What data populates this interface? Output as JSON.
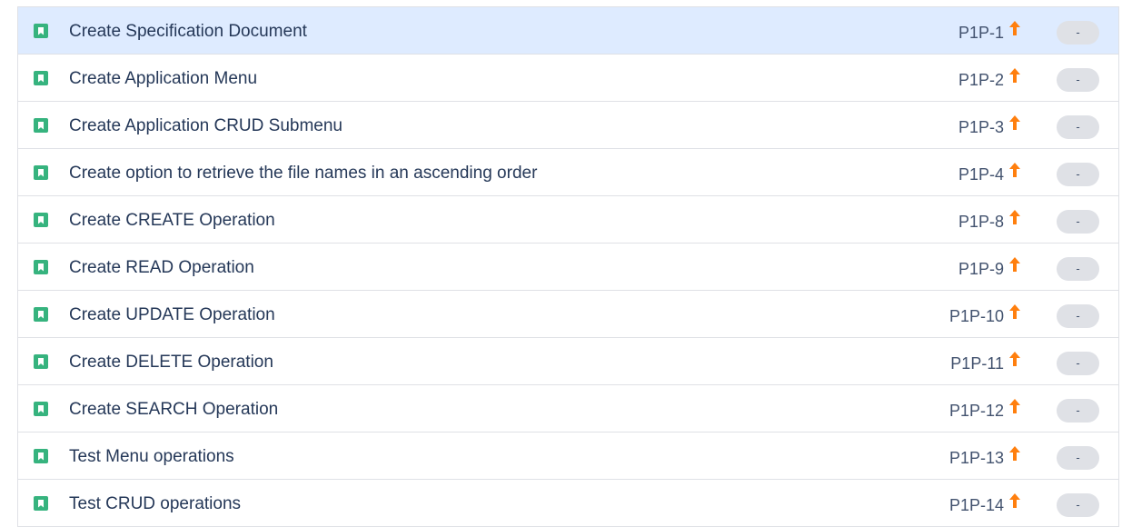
{
  "colors": {
    "story_icon": "#36b37e",
    "priority_high": "#ff7f0e",
    "selected_row": "#deebff",
    "lozenge_bg": "#dfe1e6"
  },
  "icons": {
    "type": "story-bookmark-icon",
    "priority": "arrow-up-icon"
  },
  "issues": [
    {
      "summary": "Create Specification Document",
      "key": "P1P-1",
      "priority": "High",
      "status": "-",
      "selected": true
    },
    {
      "summary": "Create Application Menu",
      "key": "P1P-2",
      "priority": "High",
      "status": "-"
    },
    {
      "summary": "Create Application CRUD Submenu",
      "key": "P1P-3",
      "priority": "High",
      "status": "-"
    },
    {
      "summary": "Create option to retrieve the file names in an ascending order",
      "key": "P1P-4",
      "priority": "High",
      "status": "-"
    },
    {
      "summary": "Create CREATE Operation",
      "key": "P1P-8",
      "priority": "High",
      "status": "-"
    },
    {
      "summary": "Create READ Operation",
      "key": "P1P-9",
      "priority": "High",
      "status": "-"
    },
    {
      "summary": "Create UPDATE Operation",
      "key": "P1P-10",
      "priority": "High",
      "status": "-"
    },
    {
      "summary": "Create DELETE Operation",
      "key": "P1P-11",
      "priority": "High",
      "status": "-"
    },
    {
      "summary": "Create SEARCH Operation",
      "key": "P1P-12",
      "priority": "High",
      "status": "-"
    },
    {
      "summary": "Test Menu operations",
      "key": "P1P-13",
      "priority": "High",
      "status": "-"
    },
    {
      "summary": "Test CRUD operations",
      "key": "P1P-14",
      "priority": "High",
      "status": "-"
    }
  ]
}
